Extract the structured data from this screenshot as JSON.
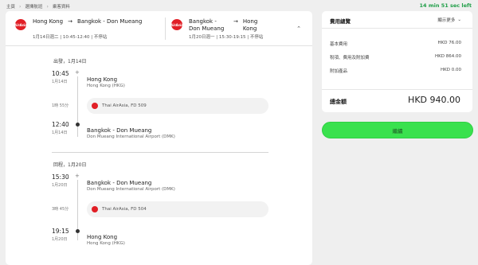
{
  "breadcrumb": {
    "items": [
      "主頁",
      "選擇航班",
      "乘客資料"
    ]
  },
  "timer": {
    "min": "14",
    "min_label": "min",
    "sec": "51",
    "sec_label": "sec left"
  },
  "summary_legs": [
    {
      "airline_logo": "AirAsia",
      "from": "Hong Kong",
      "to": "Bangkok - Don Mueang",
      "date": "1月14日週二",
      "time": "10:45-12:40",
      "stops": "不停站"
    },
    {
      "airline_logo": "AirAsia",
      "from": "Bangkok - Don Mueang",
      "to": "Hong Kong",
      "date": "1月20日週一",
      "time": "15:30-19:15",
      "stops": "不停站"
    }
  ],
  "departure": {
    "title": "出發，1月14日",
    "dep_time": "10:45",
    "dep_date": "1月14日",
    "dep_city": "Hong Kong",
    "dep_airport": "Hong Kong (HKG)",
    "duration": "1時 55分",
    "flight": "Thai AirAsia, FD 509",
    "arr_time": "12:40",
    "arr_date": "1月14日",
    "arr_city": "Bangkok - Don Mueang",
    "arr_airport": "Don Mueang International Airport (DMK)"
  },
  "return": {
    "title": "回程，1月20日",
    "dep_time": "15:30",
    "dep_date": "1月20日",
    "dep_city": "Bangkok - Don Mueang",
    "dep_airport": "Don Mueang International Airport (DMK)",
    "duration": "3時 45分",
    "flight": "Thai AirAsia, FD 504",
    "arr_time": "19:15",
    "arr_date": "1月20日",
    "arr_city": "Hong Kong",
    "arr_airport": "Hong Kong (HKG)"
  },
  "fare": {
    "title": "費用總覽",
    "show_more": "顯示更多",
    "rows": [
      {
        "label": "基本費用",
        "amount": "HKD 76.00"
      },
      {
        "label": "稅項、費用及附加費",
        "amount": "HKD 864.00"
      },
      {
        "label": "附加產品",
        "amount": "HKD 0.00"
      }
    ],
    "total_label": "總金額",
    "total_amount": "HKD 940.00"
  },
  "cta": {
    "label": "繼續"
  },
  "colors": {
    "accent_green": "#3ae14e",
    "airasia_red": "#e11f26",
    "timer_green": "#1f9e47"
  },
  "icons": {
    "breadcrumb_sep": "chevron-right-icon",
    "collapse": "chevron-up-icon",
    "show_more": "chevron-down-icon"
  }
}
